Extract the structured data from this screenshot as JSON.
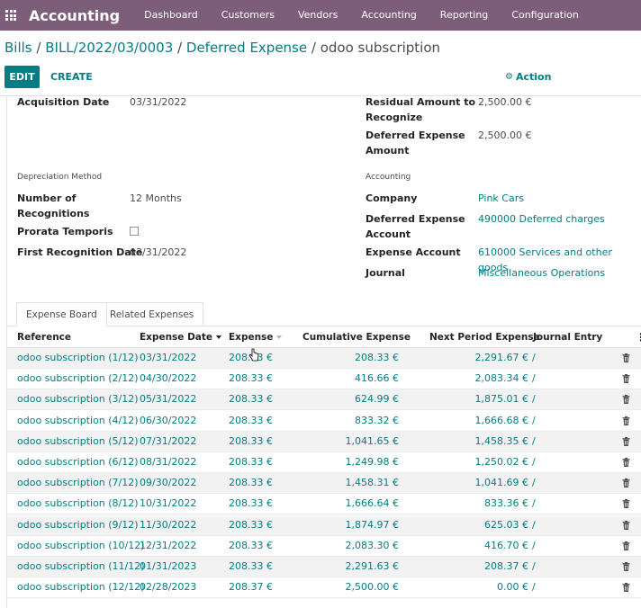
{
  "navbar": {
    "app_name": "Accounting",
    "menus": [
      "Dashboard",
      "Customers",
      "Vendors",
      "Accounting",
      "Reporting",
      "Configuration"
    ]
  },
  "breadcrumb": {
    "items": [
      "Bills",
      "BILL/2022/03/0003",
      "Deferred Expense"
    ],
    "separator": "/",
    "current": "odoo subscription"
  },
  "control": {
    "edit_label": "EDIT",
    "create_label": "CREATE",
    "action_label": "Action"
  },
  "form": {
    "acquisition_date": {
      "label": "Acquisition Date",
      "value": "03/31/2022"
    },
    "residual_amount": {
      "label_line1": "Residual Amount to",
      "label_line2": "Recognize",
      "value": "2,500.00 €"
    },
    "deferred_expense_amount": {
      "label_line1": "Deferred Expense",
      "label_line2": "Amount",
      "value": "2,500.00 €"
    },
    "depreciation_section": "Depreciation Method",
    "accounting_section": "Accounting",
    "number_of_recognitions": {
      "label_line1": "Number of",
      "label_line2": "Recognitions",
      "value": "12",
      "unit": "Months"
    },
    "prorata": {
      "label": "Prorata Temporis",
      "checked": false
    },
    "first_recognition": {
      "label": "First Recognition Date",
      "value": "03/31/2022"
    },
    "company": {
      "label": "Company",
      "value": "Pink Cars"
    },
    "deferred_account": {
      "label_line1": "Deferred Expense",
      "label_line2": "Account",
      "value": "490000 Deferred charges"
    },
    "expense_account": {
      "label": "Expense Account",
      "value": "610000 Services and other goods"
    },
    "journal": {
      "label": "Journal",
      "value": "Miscellaneous Operations"
    }
  },
  "tabs": {
    "expense_board": "Expense Board",
    "related_expenses": "Related Expenses"
  },
  "table": {
    "columns": {
      "reference": "Reference",
      "expense_date": "Expense Date",
      "expense": "Expense",
      "cumulative": "Cumulative Expense",
      "next_period": "Next Period Expense",
      "journal_entry": "Journal Entry"
    },
    "rows": [
      {
        "ref": "odoo subscription (1/12)",
        "date": "03/31/2022",
        "expense": "208.33 €",
        "cumulative": "208.33 €",
        "next": "2,291.67 €",
        "je": "/"
      },
      {
        "ref": "odoo subscription (2/12)",
        "date": "04/30/2022",
        "expense": "208.33 €",
        "cumulative": "416.66 €",
        "next": "2,083.34 €",
        "je": "/"
      },
      {
        "ref": "odoo subscription (3/12)",
        "date": "05/31/2022",
        "expense": "208.33 €",
        "cumulative": "624.99 €",
        "next": "1,875.01 €",
        "je": "/"
      },
      {
        "ref": "odoo subscription (4/12)",
        "date": "06/30/2022",
        "expense": "208.33 €",
        "cumulative": "833.32 €",
        "next": "1,666.68 €",
        "je": "/"
      },
      {
        "ref": "odoo subscription (5/12)",
        "date": "07/31/2022",
        "expense": "208.33 €",
        "cumulative": "1,041.65 €",
        "next": "1,458.35 €",
        "je": "/"
      },
      {
        "ref": "odoo subscription (6/12)",
        "date": "08/31/2022",
        "expense": "208.33 €",
        "cumulative": "1,249.98 €",
        "next": "1,250.02 €",
        "je": "/"
      },
      {
        "ref": "odoo subscription (7/12)",
        "date": "09/30/2022",
        "expense": "208.33 €",
        "cumulative": "1,458.31 €",
        "next": "1,041.69 €",
        "je": "/"
      },
      {
        "ref": "odoo subscription (8/12)",
        "date": "10/31/2022",
        "expense": "208.33 €",
        "cumulative": "1,666.64 €",
        "next": "833.36 €",
        "je": "/"
      },
      {
        "ref": "odoo subscription (9/12)",
        "date": "11/30/2022",
        "expense": "208.33 €",
        "cumulative": "1,874.97 €",
        "next": "625.03 €",
        "je": "/"
      },
      {
        "ref": "odoo subscription (10/12)",
        "date": "12/31/2022",
        "expense": "208.33 €",
        "cumulative": "2,083.30 €",
        "next": "416.70 €",
        "je": "/"
      },
      {
        "ref": "odoo subscription (11/12)",
        "date": "01/31/2023",
        "expense": "208.33 €",
        "cumulative": "2,291.63 €",
        "next": "208.37 €",
        "je": "/"
      },
      {
        "ref": "odoo subscription (12/12)",
        "date": "02/28/2023",
        "expense": "208.37 €",
        "cumulative": "2,500.00 €",
        "next": "0.00 €",
        "je": "/"
      }
    ]
  },
  "colors": {
    "navbar": "#7c5e7a",
    "primary": "#017e84",
    "text": "#4c4c4c"
  }
}
